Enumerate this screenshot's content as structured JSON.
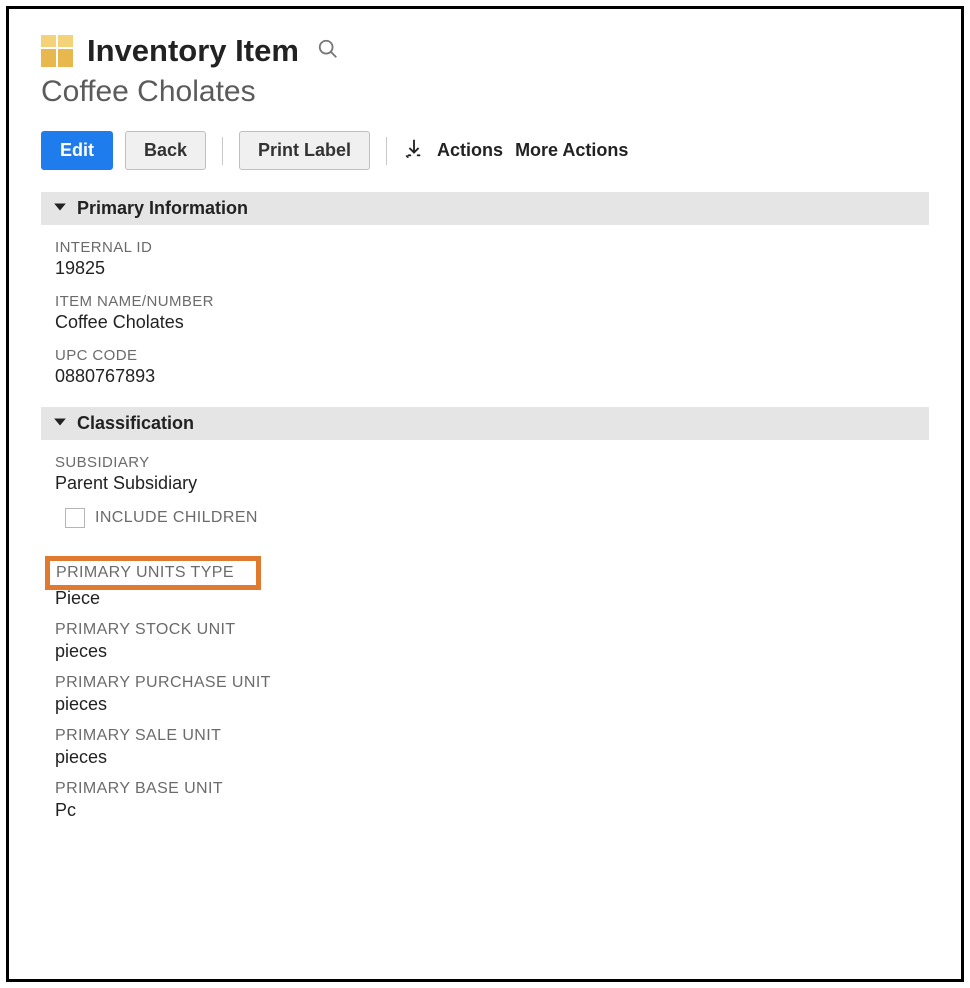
{
  "header": {
    "page_title": "Inventory Item",
    "record_name": "Coffee Cholates"
  },
  "toolbar": {
    "edit": "Edit",
    "back": "Back",
    "print_label": "Print Label",
    "actions": "Actions",
    "more_actions": "More Actions"
  },
  "sections": {
    "primary_info": {
      "title": "Primary Information",
      "fields": {
        "internal_id": {
          "label": "INTERNAL ID",
          "value": "19825"
        },
        "item_name": {
          "label": "ITEM NAME/NUMBER",
          "value": "Coffee Cholates"
        },
        "upc_code": {
          "label": "UPC CODE",
          "value": "0880767893"
        }
      }
    },
    "classification": {
      "title": "Classification",
      "fields": {
        "subsidiary": {
          "label": "SUBSIDIARY",
          "value": "Parent Subsidiary"
        },
        "include_children": {
          "label": "INCLUDE CHILDREN",
          "checked": false
        }
      }
    },
    "units": {
      "primary_units_type": {
        "label": "PRIMARY UNITS TYPE",
        "value": "Piece"
      },
      "primary_stock_unit": {
        "label": "PRIMARY STOCK UNIT",
        "value": "pieces"
      },
      "primary_purchase_unit": {
        "label": "PRIMARY PURCHASE UNIT",
        "value": "pieces"
      },
      "primary_sale_unit": {
        "label": "PRIMARY SALE UNIT",
        "value": "pieces"
      },
      "primary_base_unit": {
        "label": "PRIMARY BASE UNIT",
        "value": "Pc"
      }
    }
  }
}
